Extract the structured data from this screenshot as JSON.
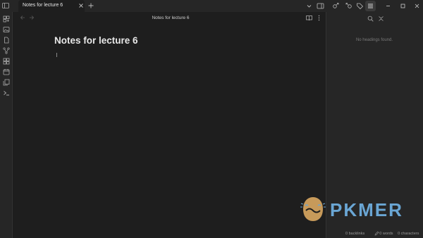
{
  "tab": {
    "label": "Notes for lecture 6"
  },
  "view_header": {
    "title": "Notes for lecture 6"
  },
  "note": {
    "title": "Notes for lecture 6"
  },
  "outline": {
    "empty_message": "No headings found."
  },
  "status_bar": {
    "backlinks": "0 backlinks",
    "words": "0 words",
    "characters": "0 characters"
  },
  "watermark": {
    "text": "PKMER"
  },
  "colors": {
    "background": "#1e1e1e",
    "panel": "#262626",
    "watermark": "#6aa6d4"
  }
}
